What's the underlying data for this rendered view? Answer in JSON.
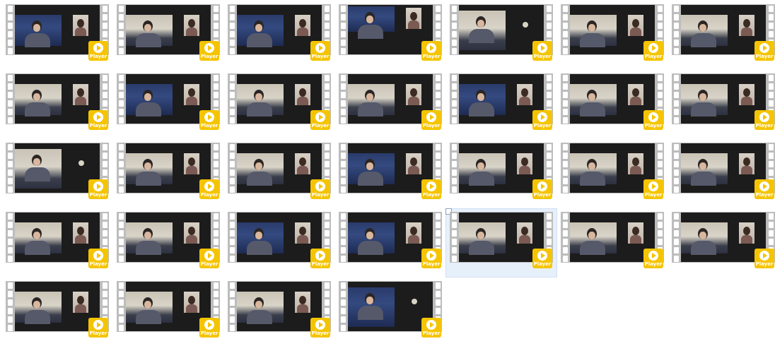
{
  "badge_label": "Player",
  "colors": {
    "badge": "#f5c400",
    "selection": "#e6f0fb",
    "film": "#bdbdbd"
  },
  "icons": {
    "play": "play-circle-icon"
  },
  "files": [
    {
      "name": "",
      "variant": "blue"
    },
    {
      "name": "",
      "variant": "room"
    },
    {
      "name": "",
      "variant": "blue"
    },
    {
      "name": "",
      "variant": "dark"
    },
    {
      "name": "",
      "variant": "dot"
    },
    {
      "name": "",
      "variant": "room"
    },
    {
      "name": "",
      "variant": "room"
    },
    {
      "name": "",
      "variant": "room"
    },
    {
      "name": "",
      "variant": "blue"
    },
    {
      "name": "",
      "variant": "room"
    },
    {
      "name": "",
      "variant": "room"
    },
    {
      "name": "",
      "variant": "blue"
    },
    {
      "name": "",
      "variant": "room"
    },
    {
      "name": "",
      "variant": "room"
    },
    {
      "name": "",
      "variant": "dot"
    },
    {
      "name": "",
      "variant": "room"
    },
    {
      "name": "",
      "variant": "room"
    },
    {
      "name": "",
      "variant": "blue"
    },
    {
      "name": "",
      "variant": "room"
    },
    {
      "name": "",
      "variant": "room"
    },
    {
      "name": "",
      "variant": "room"
    },
    {
      "name": "",
      "variant": "room"
    },
    {
      "name": "",
      "variant": "room"
    },
    {
      "name": "",
      "variant": "blue"
    },
    {
      "name": "",
      "variant": "blue"
    },
    {
      "name": "",
      "variant": "room",
      "selected": true
    },
    {
      "name": "",
      "variant": "room"
    },
    {
      "name": "",
      "variant": "room"
    },
    {
      "name": "",
      "variant": "room"
    },
    {
      "name": "",
      "variant": "room"
    },
    {
      "name": "",
      "variant": "room"
    },
    {
      "name": "",
      "variant": "dark-dot"
    }
  ]
}
